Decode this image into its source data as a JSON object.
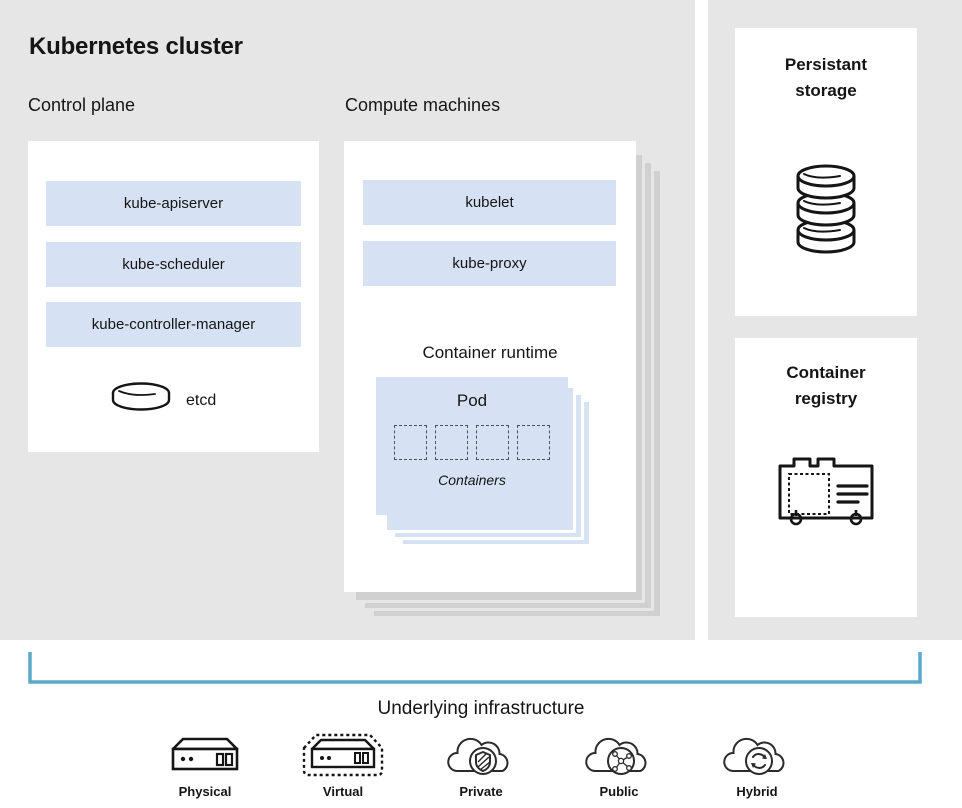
{
  "cluster": {
    "title": "Kubernetes cluster",
    "control_plane": {
      "title": "Control plane",
      "components": [
        "kube-apiserver",
        "kube-scheduler",
        "kube-controller-manager"
      ],
      "datastore": {
        "label": "etcd",
        "icon": "database-cylinder-icon"
      }
    },
    "compute_machines": {
      "title": "Compute machines",
      "components": [
        "kubelet",
        "kube-proxy"
      ],
      "container_runtime": {
        "title": "Container runtime",
        "pod": {
          "label": "Pod",
          "containers_label": "Containers",
          "container_count": 4
        },
        "pod_stack_count": 4
      },
      "machine_stack_count": 4
    }
  },
  "side_panels": [
    {
      "title": "Persistant\nstorage",
      "title_line1": "Persistant",
      "title_line2": "storage",
      "icon": "stacked-database-icon"
    },
    {
      "title": "Container\nregistry",
      "title_line1": "Container",
      "title_line2": "registry",
      "icon": "registry-crate-icon"
    }
  ],
  "infrastructure": {
    "title": "Underlying infrastructure",
    "items": [
      {
        "label": "Physical",
        "icon": "server-icon"
      },
      {
        "label": "Virtual",
        "icon": "server-dashed-icon"
      },
      {
        "label": "Private",
        "icon": "cloud-shield-icon"
      },
      {
        "label": "Public",
        "icon": "cloud-network-icon"
      },
      {
        "label": "Hybrid",
        "icon": "cloud-sync-icon"
      }
    ]
  },
  "colors": {
    "panel_background": "#e6e6e6",
    "card_background": "#ffffff",
    "component_blue": "#d6e2f3",
    "bracket_blue": "#5ba8c9",
    "shadow_gray": "#d0d0d0",
    "text": "#151515"
  }
}
